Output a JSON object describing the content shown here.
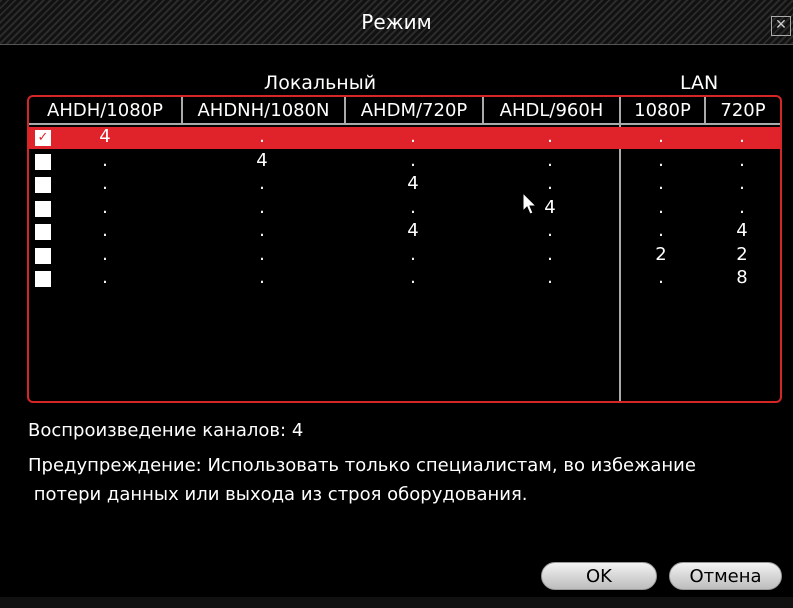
{
  "dialog": {
    "title": "Режим",
    "close_symbol": "✕"
  },
  "sections": {
    "local": "Локальный",
    "lan": "LAN"
  },
  "columns": [
    "AHDH/1080P",
    "AHDNH/1080N",
    "AHDM/720P",
    "AHDL/960H",
    "1080P",
    "720P"
  ],
  "rows": [
    {
      "checked": true,
      "selected": true,
      "cells": [
        "4",
        ".",
        ".",
        ".",
        ".",
        "."
      ]
    },
    {
      "checked": false,
      "selected": false,
      "cells": [
        ".",
        "4",
        ".",
        ".",
        ".",
        "."
      ]
    },
    {
      "checked": false,
      "selected": false,
      "cells": [
        ".",
        ".",
        "4",
        ".",
        ".",
        "."
      ]
    },
    {
      "checked": false,
      "selected": false,
      "cells": [
        ".",
        ".",
        ".",
        "4",
        ".",
        "."
      ]
    },
    {
      "checked": false,
      "selected": false,
      "cells": [
        ".",
        ".",
        "4",
        ".",
        ".",
        "4"
      ]
    },
    {
      "checked": false,
      "selected": false,
      "cells": [
        ".",
        ".",
        ".",
        ".",
        "2",
        "2"
      ]
    },
    {
      "checked": false,
      "selected": false,
      "cells": [
        ".",
        ".",
        ".",
        ".",
        ".",
        "8"
      ]
    }
  ],
  "playback": "Воспроизведение каналов: 4",
  "warning_line1": "Предупреждение: Использовать только специалистам, во избежание",
  "warning_line2": " потери данных или выхода из строя оборудования.",
  "buttons": {
    "ok": "OK",
    "cancel": "Отмена"
  },
  "check_mark": "✓"
}
